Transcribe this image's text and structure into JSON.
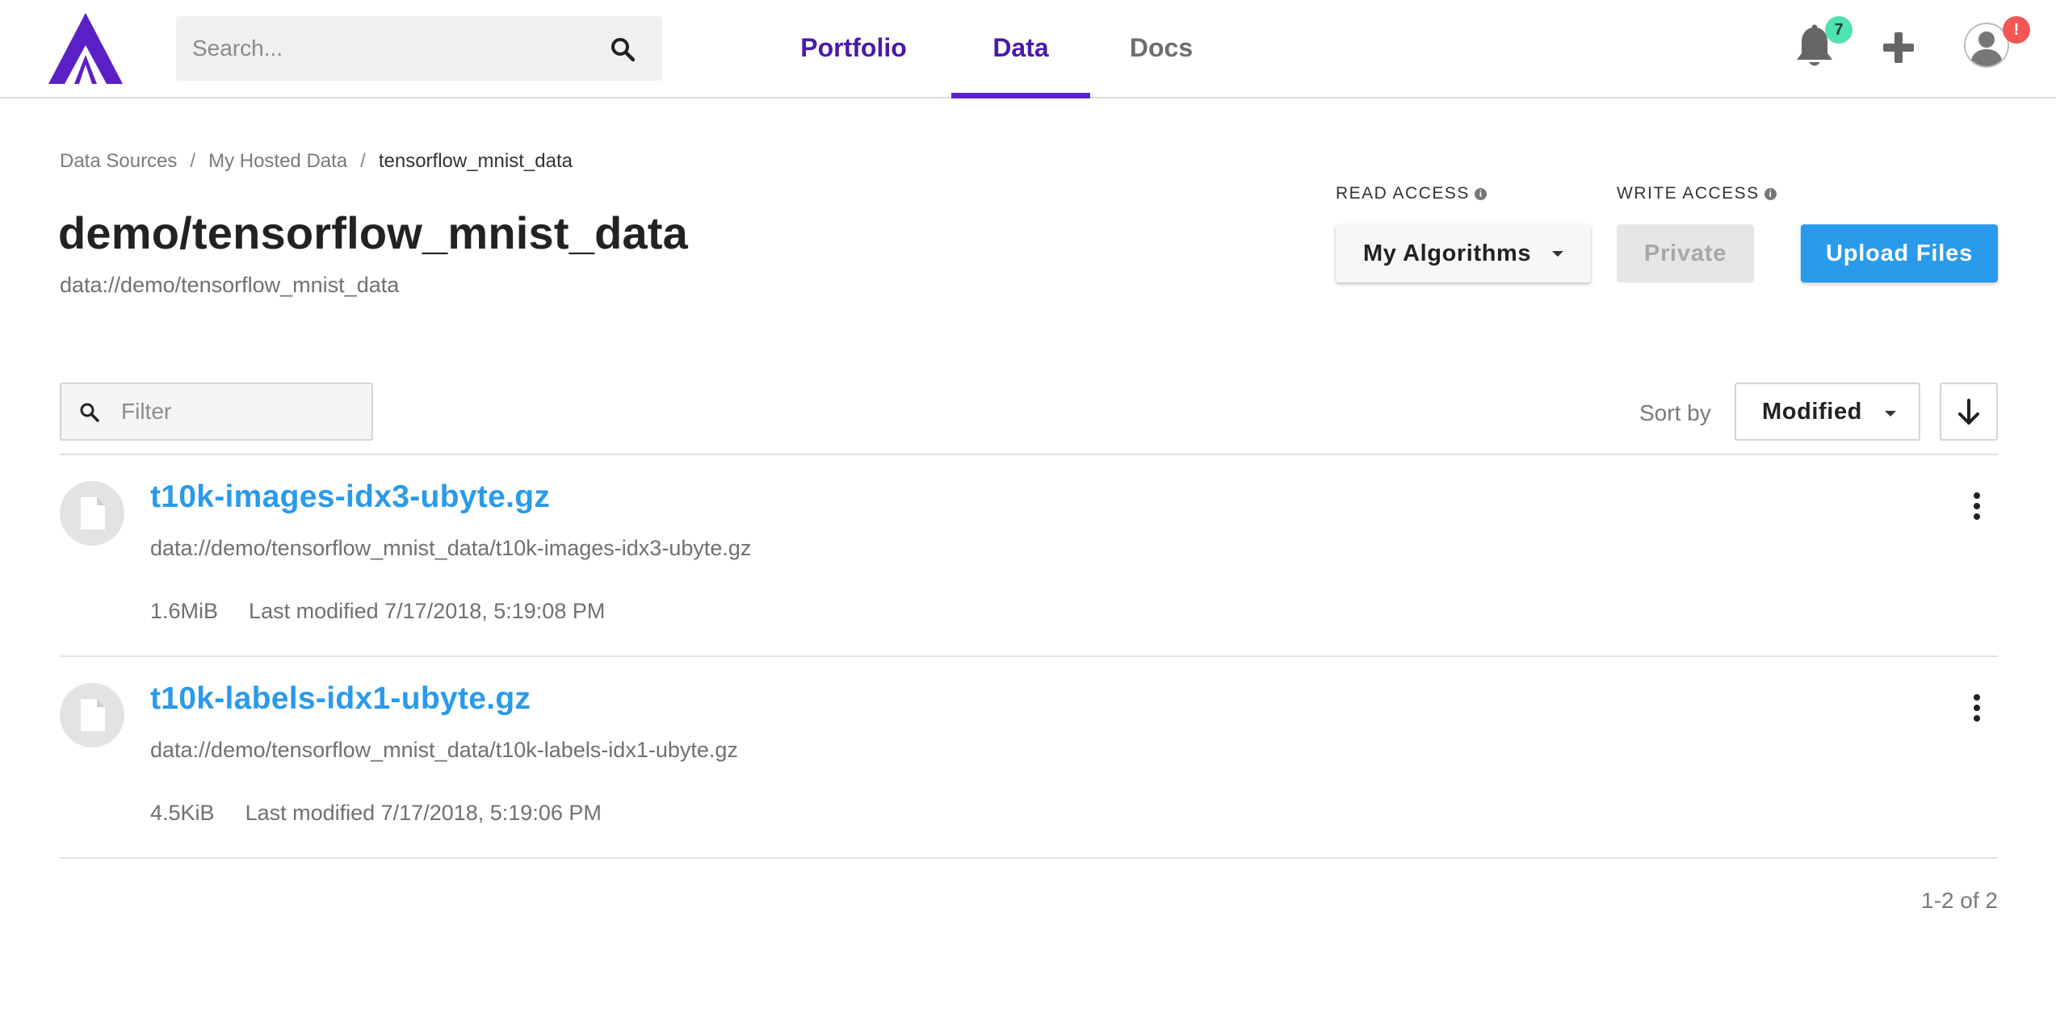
{
  "header": {
    "search_placeholder": "Search...",
    "nav": [
      "Portfolio",
      "Data",
      "Docs"
    ],
    "active_nav": "Data",
    "notifications_count": "7",
    "profile_alert": "!",
    "accent_color": "#4a1aa8",
    "icons": [
      "algorithmia-logo-icon",
      "search-icon",
      "bell-icon",
      "plus-icon",
      "user-avatar-icon"
    ]
  },
  "breadcrumb": [
    "Data Sources",
    "My Hosted Data",
    "tensorflow_mnist_data"
  ],
  "collection": {
    "title": "demo/tensorflow_mnist_data",
    "path": "data://demo/tensorflow_mnist_data"
  },
  "access": {
    "read_label": "READ ACCESS",
    "read_value": "My Algorithms",
    "write_label": "WRITE ACCESS",
    "write_value": "Private",
    "info_glyph": "i"
  },
  "upload_label": "Upload Files",
  "filter_placeholder": "Filter",
  "sort": {
    "label": "Sort by",
    "value": "Modified",
    "direction": "descending"
  },
  "files": [
    {
      "name": "t10k-images-idx3-ubyte.gz",
      "path": "data://demo/tensorflow_mnist_data/t10k-images-idx3-ubyte.gz",
      "size": "1.6MiB",
      "modified": "Last modified 7/17/2018, 5:19:08 PM"
    },
    {
      "name": "t10k-labels-idx1-ubyte.gz",
      "path": "data://demo/tensorflow_mnist_data/t10k-labels-idx1-ubyte.gz",
      "size": "4.5KiB",
      "modified": "Last modified 7/17/2018, 5:19:06 PM"
    }
  ],
  "pagination": "1-2 of 2",
  "colors": {
    "brand_purple": "#5c23c8",
    "link_blue": "#2a9aea",
    "notification_green": "#4fe3b0",
    "alert_red": "#f25656"
  }
}
